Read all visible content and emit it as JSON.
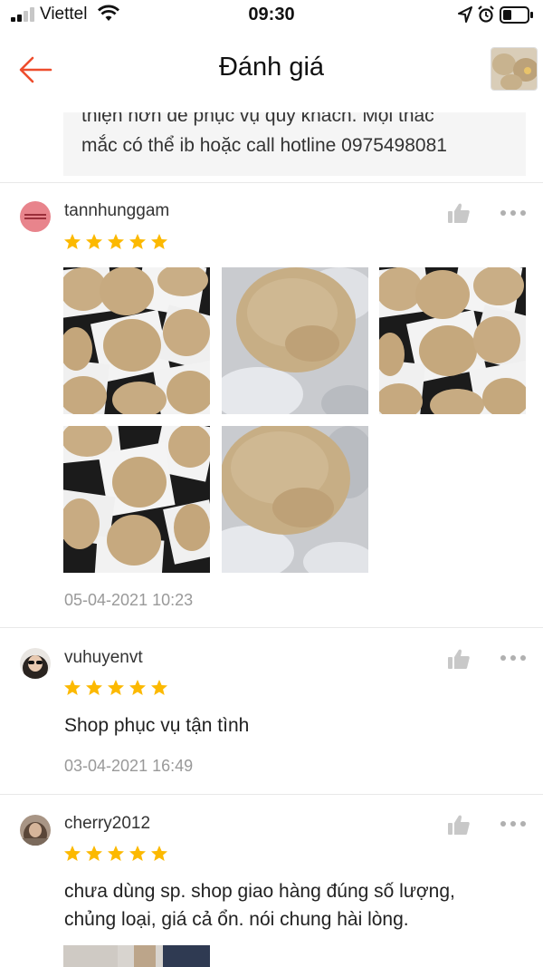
{
  "status_bar": {
    "carrier": "Viettel",
    "time": "09:30"
  },
  "header": {
    "title": "Đánh giá",
    "back_icon": "arrow-left-icon",
    "accent_color": "#ee4d2d"
  },
  "shop_reply": {
    "line1": "thiện hơn để phục vụ quý khách. Mọi thắc",
    "line2": "mắc có thể ib hoặc call hotline 0975498081"
  },
  "reviews": [
    {
      "username": "tannhunggam",
      "rating": 5,
      "photos": [
        "cookies-on-paper",
        "cookie-closeup",
        "cookies-on-paper",
        "cookies-on-paper",
        "cookie-closeup"
      ],
      "date": "05-04-2021 10:23"
    },
    {
      "username": "vuhuyenvt",
      "rating": 5,
      "text": "Shop phục vụ tận tình",
      "date": "03-04-2021 16:49"
    },
    {
      "username": "cherry2012",
      "rating": 5,
      "text_line1": "chưa dùng sp. shop giao hàng đúng số lượng,",
      "text_line2": "chủng loại, giá cả ổn. nói chung hài lòng."
    }
  ],
  "colors": {
    "star": "#fcb900",
    "icon_grey": "#c8c8c8",
    "date_grey": "#999999"
  }
}
